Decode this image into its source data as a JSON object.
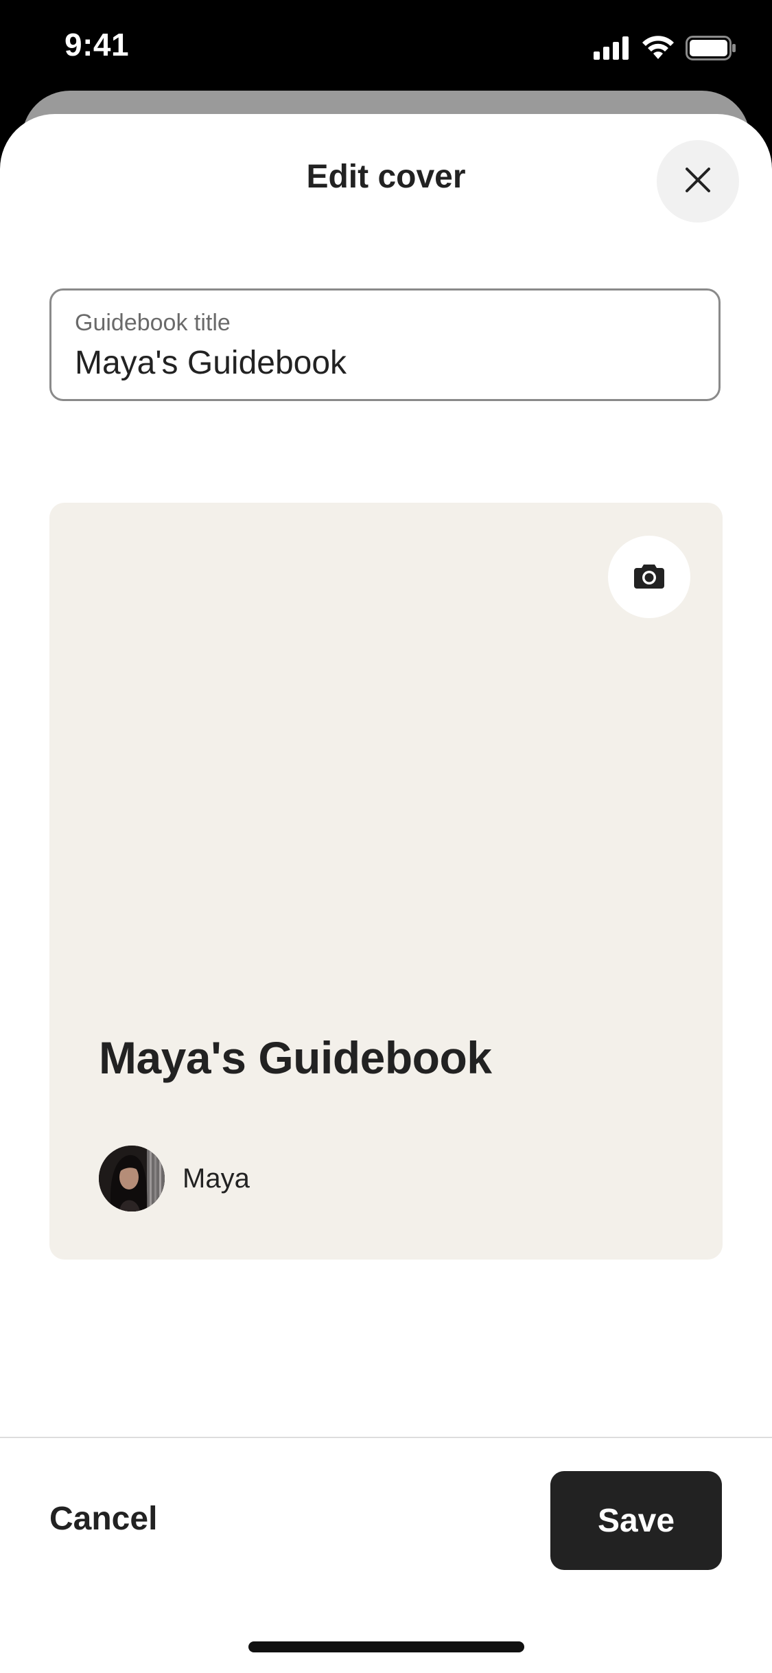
{
  "status_bar": {
    "time": "9:41"
  },
  "sheet": {
    "title": "Edit cover",
    "close_icon": "close-icon"
  },
  "title_field": {
    "label": "Guidebook title",
    "value": "Maya's Guidebook"
  },
  "cover": {
    "camera_icon": "camera-icon",
    "title": "Maya's Guidebook",
    "author_name": "Maya",
    "background_color": "#f3f0ea"
  },
  "footer": {
    "cancel_label": "Cancel",
    "save_label": "Save"
  },
  "colors": {
    "primary_text": "#222222",
    "save_button_bg": "#222222",
    "field_border": "#8a8a8a"
  }
}
